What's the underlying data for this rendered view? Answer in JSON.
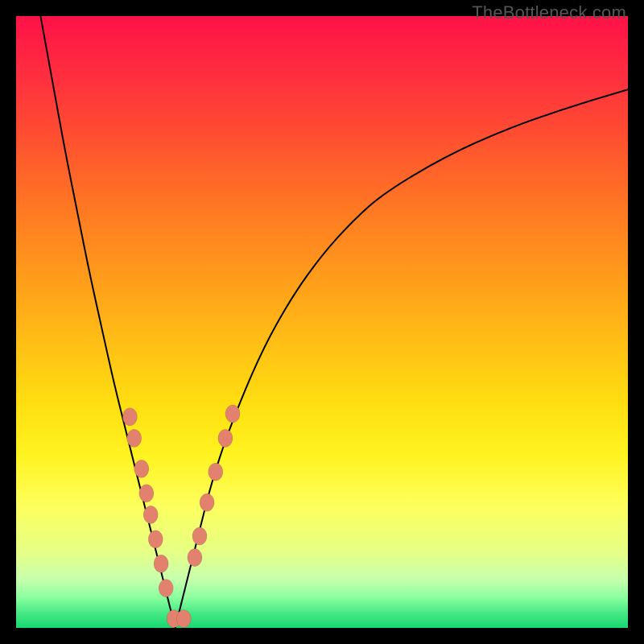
{
  "attribution": "TheBottleneck.com",
  "colors": {
    "marker": "#e3816f",
    "curve": "#000000",
    "frame": "#000000"
  },
  "chart_data": {
    "type": "line",
    "title": "",
    "xlabel": "",
    "ylabel": "",
    "xlim": [
      0,
      100
    ],
    "ylim": [
      0,
      100
    ],
    "grid": false,
    "legend": false,
    "description": "V-shaped bottleneck curve on a red-yellow-green vertical gradient. Vertex (0% bottleneck) around x≈26. Left branch rises steeply to 100% at x≈4; right branch rises asymptotically toward ~88% at x=100. Salmon markers run along both branches in the lower ~35% of the chart with a few at the vertex.",
    "vertex_x": 26,
    "series": [
      {
        "name": "left-branch",
        "x": [
          4.0,
          6.0,
          8.0,
          10.0,
          12.0,
          14.0,
          16.0,
          18.0,
          20.0,
          22.0,
          24.0,
          26.0
        ],
        "y": [
          100,
          89,
          78,
          68,
          58,
          49,
          40,
          32,
          24,
          16,
          8,
          0
        ]
      },
      {
        "name": "right-branch",
        "x": [
          26.0,
          28.0,
          30.0,
          32.0,
          35.0,
          40.0,
          45.0,
          50.0,
          55.0,
          60.0,
          70.0,
          80.0,
          90.0,
          100.0
        ],
        "y": [
          0,
          8,
          16,
          24,
          33,
          45,
          54,
          61,
          66.5,
          71,
          77,
          81.5,
          85,
          88
        ]
      }
    ],
    "markers": [
      {
        "branch": "left",
        "x": 18.6,
        "y": 34.5
      },
      {
        "branch": "left",
        "x": 19.3,
        "y": 31.0
      },
      {
        "branch": "left",
        "x": 20.5,
        "y": 26.0
      },
      {
        "branch": "left",
        "x": 21.3,
        "y": 22.0
      },
      {
        "branch": "left",
        "x": 22.0,
        "y": 18.5
      },
      {
        "branch": "left",
        "x": 22.8,
        "y": 14.5
      },
      {
        "branch": "left",
        "x": 23.7,
        "y": 10.5
      },
      {
        "branch": "left",
        "x": 24.5,
        "y": 6.5
      },
      {
        "branch": "vertex",
        "x": 25.8,
        "y": 1.5
      },
      {
        "branch": "vertex",
        "x": 27.4,
        "y": 1.5
      },
      {
        "branch": "right",
        "x": 29.2,
        "y": 11.5
      },
      {
        "branch": "right",
        "x": 30.0,
        "y": 15.0
      },
      {
        "branch": "right",
        "x": 31.2,
        "y": 20.5
      },
      {
        "branch": "right",
        "x": 32.6,
        "y": 25.5
      },
      {
        "branch": "right",
        "x": 34.2,
        "y": 31.0
      },
      {
        "branch": "right",
        "x": 35.4,
        "y": 35.0
      }
    ]
  }
}
